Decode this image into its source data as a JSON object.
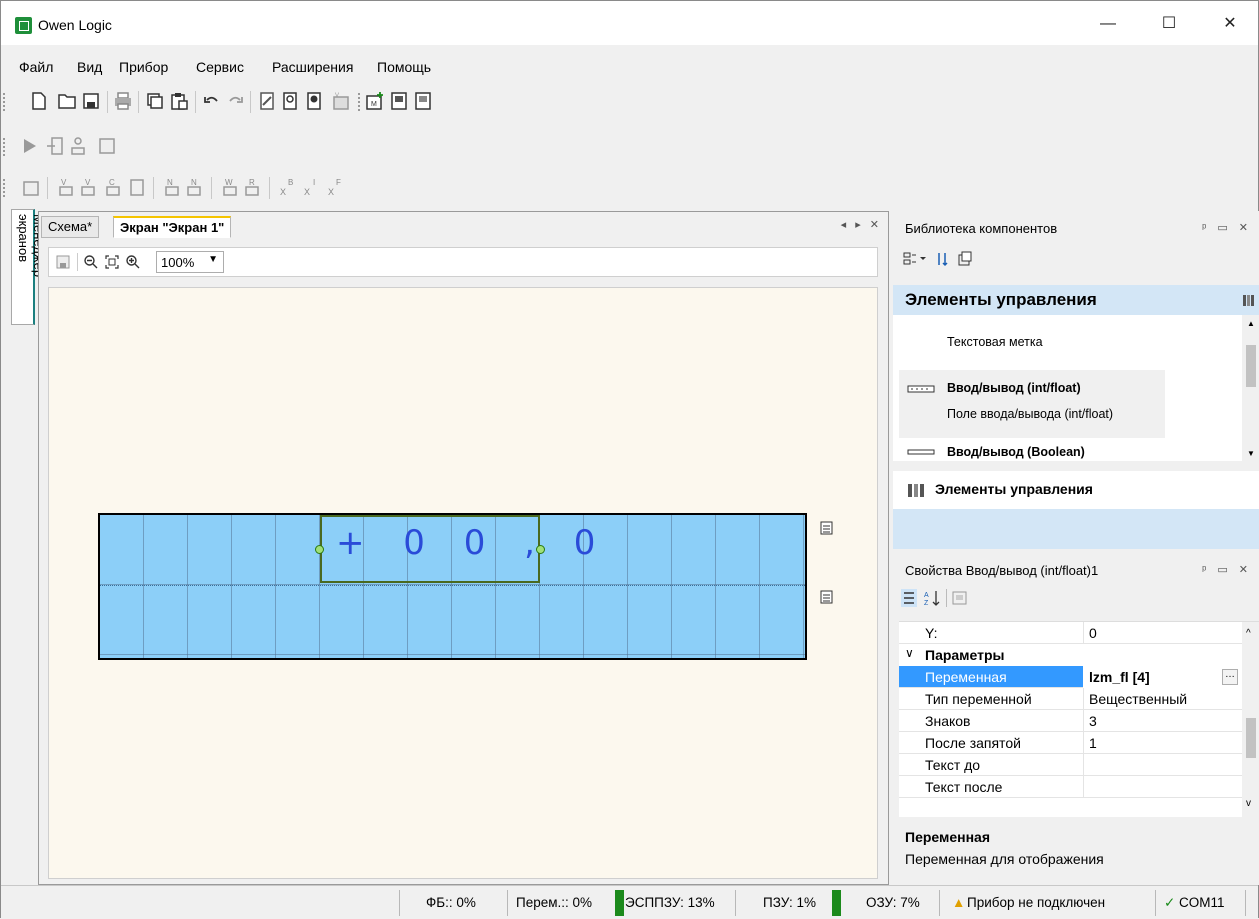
{
  "window": {
    "title": "Owen Logic",
    "minimize": "—",
    "maximize": "☐",
    "close": "✕"
  },
  "menu": [
    "Файл",
    "Вид",
    "Прибор",
    "Сервис",
    "Расширения",
    "Помощь"
  ],
  "doc_tabs": [
    "Схема*",
    "Экран \"Экран 1\""
  ],
  "side_tab": "Менеджер экранов",
  "canvas_toolbar": {
    "zoom": "100%"
  },
  "lcd": {
    "field_text": "+ 0 0 , 0"
  },
  "library": {
    "title": "Библиотека компонентов",
    "category": "Элементы управления",
    "items": [
      {
        "desc": "Текстовая метка"
      },
      {
        "title": "Ввод/вывод (int/float)",
        "desc": "Поле ввода/вывода (int/float)"
      },
      {
        "title": "Ввод/вывод (Boolean)"
      }
    ],
    "group": "Элементы управления"
  },
  "properties": {
    "title": "Свойства Ввод/вывод (int/float)1",
    "rows": [
      {
        "key": "Y:",
        "value": "0"
      },
      {
        "key": "Переменная",
        "value": "lzm_fl [4]"
      },
      {
        "key": "Тип переменной",
        "value": "Вещественный"
      },
      {
        "key": "Знаков",
        "value": "3"
      },
      {
        "key": "После запятой",
        "value": "1"
      },
      {
        "key": "Текст до",
        "value": ""
      },
      {
        "key": "Текст после",
        "value": ""
      }
    ],
    "section": "Параметры",
    "desc_title": "Переменная",
    "desc_text": "Переменная для отображения"
  },
  "status": {
    "fb": "ФБ:: 0%",
    "vars": "Перем.:: 0%",
    "eeprom": "ЭСППЗУ: 13%",
    "rom": "ПЗУ: 1%",
    "ram": "ОЗУ: 7%",
    "device": "Прибор не подключен",
    "port": "COM11"
  }
}
